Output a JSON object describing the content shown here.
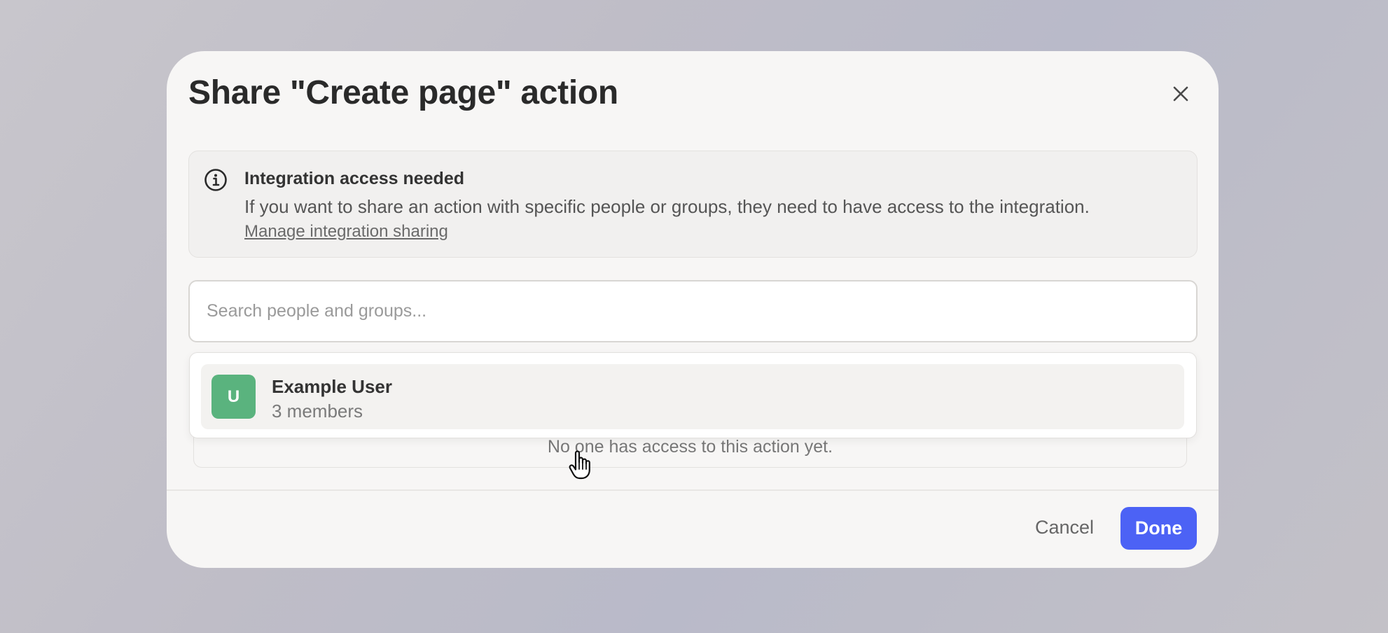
{
  "modal": {
    "title": "Share \"Create page\" action",
    "close_icon": "close-icon"
  },
  "notice": {
    "icon": "info-icon",
    "title": "Integration access needed",
    "body": "If you want to share an action with specific people or groups, they need to have access to the integration.",
    "link": "Manage integration sharing"
  },
  "search": {
    "placeholder": "Search people and groups...",
    "value": ""
  },
  "dropdown": {
    "options": [
      {
        "avatar_letter": "U",
        "avatar_color": "#5ab37e",
        "name": "Example User",
        "subtitle": "3 members"
      }
    ]
  },
  "access_list": {
    "empty_text": "No one has access to this action yet."
  },
  "footer": {
    "cancel_label": "Cancel",
    "done_label": "Done",
    "done_color": "#4c62f5"
  },
  "cursor": "hand-pointer-icon"
}
